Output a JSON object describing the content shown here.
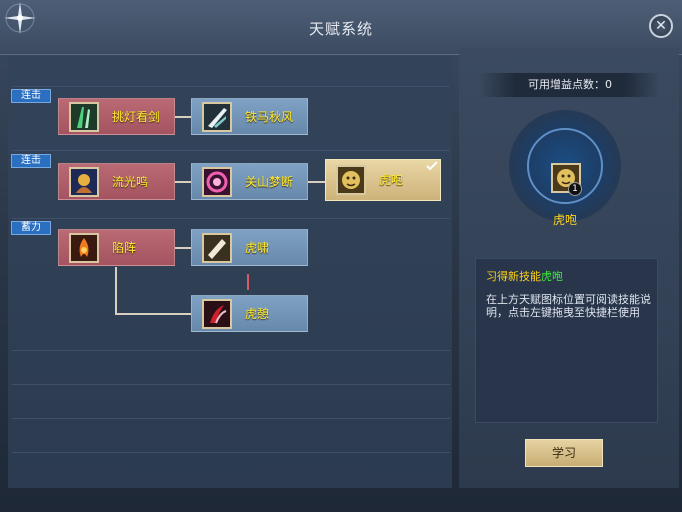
{
  "window": {
    "title": "天赋系统"
  },
  "rows": [
    {
      "label": "连击"
    },
    {
      "label": "连击"
    },
    {
      "label": "蓄力"
    }
  ],
  "nodes": [
    {
      "label": "挑灯看剑",
      "icon": "green-blade-skill-icon",
      "color": "red"
    },
    {
      "label": "铁马秋风",
      "icon": "white-slash-skill-icon",
      "color": "blue"
    },
    {
      "label": "流光鸣",
      "icon": "golden-warrior-skill-icon",
      "color": "red"
    },
    {
      "label": "关山梦断",
      "icon": "pink-swirl-skill-icon",
      "color": "blue"
    },
    {
      "label": "虎咆",
      "icon": "tiger-head-skill-icon",
      "color": "gold",
      "selected": true
    },
    {
      "label": "陷阵",
      "icon": "fire-charge-skill-icon",
      "color": "red"
    },
    {
      "label": "虎啸",
      "icon": "white-wedge-skill-icon",
      "color": "blue"
    },
    {
      "label": "虎憩",
      "icon": "red-claw-skill-icon",
      "color": "blue"
    }
  ],
  "side": {
    "points_text": "可用增益点数：0",
    "points_value": 0,
    "selected_name": "虎咆",
    "selected_badge": "1",
    "learn_prefix": "习得新技能",
    "learn_skill": "虎咆",
    "description": "在上方天赋图标位置可阅读技能说明，点击左键拖曳至快捷栏使用",
    "learn_button": "学习"
  },
  "colors": {
    "accent_yellow": "#ffea2e",
    "highlight_green": "#3bee3b",
    "row_label_blue": "#2a6fc0"
  }
}
